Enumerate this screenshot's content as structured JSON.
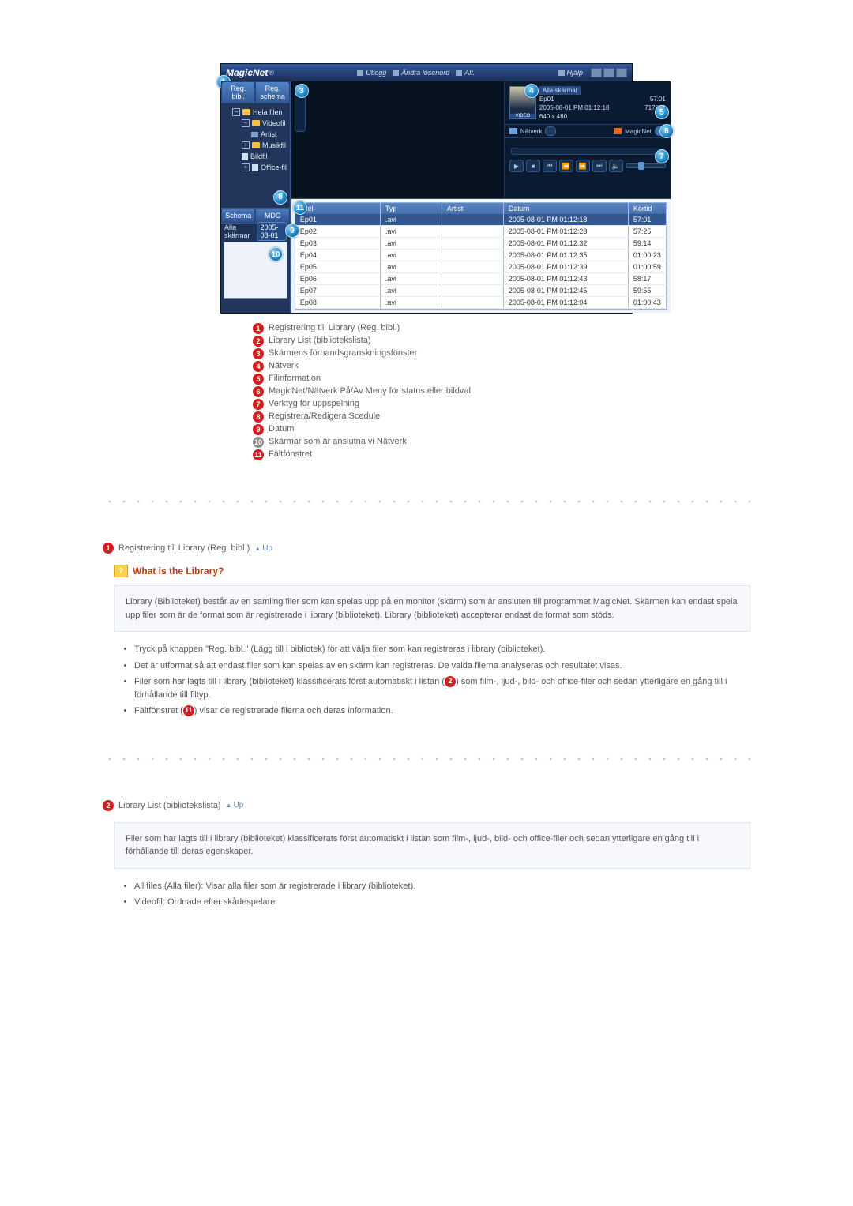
{
  "app": {
    "logo": "MagicNet",
    "toolbar": {
      "logout": "Utlogg",
      "change_password": "Ändra lösenord",
      "alt": "Alt.",
      "help": "Hjälp"
    },
    "sidebar": {
      "tabs": {
        "reg_bibl": "Reg. bibl.",
        "reg_schema": "Reg. schema"
      },
      "tree": {
        "root": "Hela filen",
        "video": "Videofil",
        "artist": "Artist",
        "music": "Musikfil",
        "image": "Bildfil",
        "office": "Office-fil"
      },
      "sub_tabs": {
        "schema": "Schema",
        "mdc": "MDC"
      },
      "row2": {
        "label": "Alla skärmar",
        "date": "2005-08-01"
      }
    },
    "detail": {
      "header": "Alla skärmar",
      "title": "Ep01",
      "date": "2005-08-01 PM 01:12:18",
      "res": "640 x 480",
      "dur": "57:01",
      "size": "717818",
      "net_label": "Nätverk",
      "magicnet_label": "MagicNet"
    },
    "table": {
      "headers": {
        "title": "Titel",
        "type": "Typ",
        "artist": "Artist",
        "date": "Datum",
        "dur": "Körtid"
      },
      "rows": [
        {
          "title": "Ep01",
          "type": ".avi",
          "artist": "",
          "date": "2005-08-01 PM 01:12:18",
          "dur": "57:01"
        },
        {
          "title": "Ep02",
          "type": ".avi",
          "artist": "",
          "date": "2005-08-01 PM 01:12:28",
          "dur": "57:25"
        },
        {
          "title": "Ep03",
          "type": ".avi",
          "artist": "",
          "date": "2005-08-01 PM 01:12:32",
          "dur": "59:14"
        },
        {
          "title": "Ep04",
          "type": ".avi",
          "artist": "",
          "date": "2005-08-01 PM 01:12:35",
          "dur": "01:00:23"
        },
        {
          "title": "Ep05",
          "type": ".avi",
          "artist": "",
          "date": "2005-08-01 PM 01:12:39",
          "dur": "01:00:59"
        },
        {
          "title": "Ep06",
          "type": ".avi",
          "artist": "",
          "date": "2005-08-01 PM 01:12:43",
          "dur": "58:17"
        },
        {
          "title": "Ep07",
          "type": ".avi",
          "artist": "",
          "date": "2005-08-01 PM 01:12:45",
          "dur": "59:55"
        },
        {
          "title": "Ep08",
          "type": ".avi",
          "artist": "",
          "date": "2005-08-01 PM 01:12:04",
          "dur": "01:00:43"
        }
      ]
    }
  },
  "legend": [
    "Registrering till Library (Reg. bibl.)",
    "Library List (bibliotekslista)",
    "Skärmens förhandsgranskningsfönster",
    "Nätverk",
    "Filinformation",
    "MagicNet/Nätverk På/Av Meny för status eller bildval",
    "Verktyg för uppspelning",
    "Registrera/Redigera Scedule",
    "Datum",
    "Skärmar som är anslutna vi Nätverk",
    "Fältfönstret"
  ],
  "section1": {
    "heading": "Registrering till Library (Reg. bibl.)",
    "up": "Up",
    "q_title": "What is the Library?",
    "box": "Library (Biblioteket) består av en samling filer som kan spelas upp på en monitor (skärm) som är ansluten till programmet MagicNet. Skärmen kan endast spela upp filer som är de format som är registrerade i library (biblioteket). Library (biblioteket) accepterar endast de format som stöds.",
    "bullets": [
      "Tryck på knappen \"Reg. bibl.\" (Lägg till i bibliotek) för att välja filer som kan registreras i library (biblioteket).",
      "Det är utformat så att endast filer som kan spelas av en skärm kan registreras. De valda filerna analyseras och resultatet visas.",
      "Filer som har lagts till i library (biblioteket) klassificerats först automatiskt i listan (②) som film-, ljud-, bild- och office-filer och sedan ytterligare en gång till i förhållande till filtyp.",
      "Fältfönstret (⑪) visar de registrerade filerna och deras information."
    ],
    "inline_ref_a": "2",
    "inline_ref_b": "11"
  },
  "section2": {
    "heading": "Library List (bibliotekslista)",
    "up": "Up",
    "box": "Filer som har lagts till i library (biblioteket) klassificerats först automatiskt i listan som film-, ljud-, bild- och office-filer och sedan ytterligare en gång till i förhållande till deras egenskaper.",
    "bullets": [
      "All files (Alla filer): Visar alla filer som är registrerade i library (biblioteket).",
      "Videofil: Ordnade efter skådespelare"
    ]
  }
}
